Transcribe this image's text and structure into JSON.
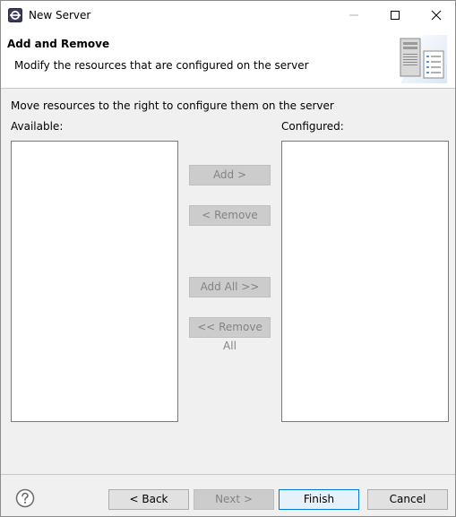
{
  "window": {
    "title": "New Server",
    "app_icon": "eclipse-icon",
    "controls": [
      "minimize-icon",
      "maximize-icon",
      "close-icon"
    ]
  },
  "header": {
    "title": "Add and Remove",
    "description": "Modify the resources that are configured on the server",
    "image": "server-wizard-icon"
  },
  "body": {
    "instructions": "Move resources to the right to configure them on the server",
    "available_label": "Available:",
    "configured_label": "Configured:",
    "available_items": [],
    "configured_items": [],
    "buttons": {
      "add": "Add >",
      "remove": "< Remove",
      "add_all": "Add All >>",
      "remove_all": "<< Remove All"
    }
  },
  "footer": {
    "help_icon": "help-icon",
    "back": "< Back",
    "next": "Next >",
    "finish": "Finish",
    "cancel": "Cancel"
  },
  "colors": {
    "disabled_button_bg": "#cccccc",
    "disabled_text": "#838383",
    "default_button_border": "#0078d7"
  }
}
